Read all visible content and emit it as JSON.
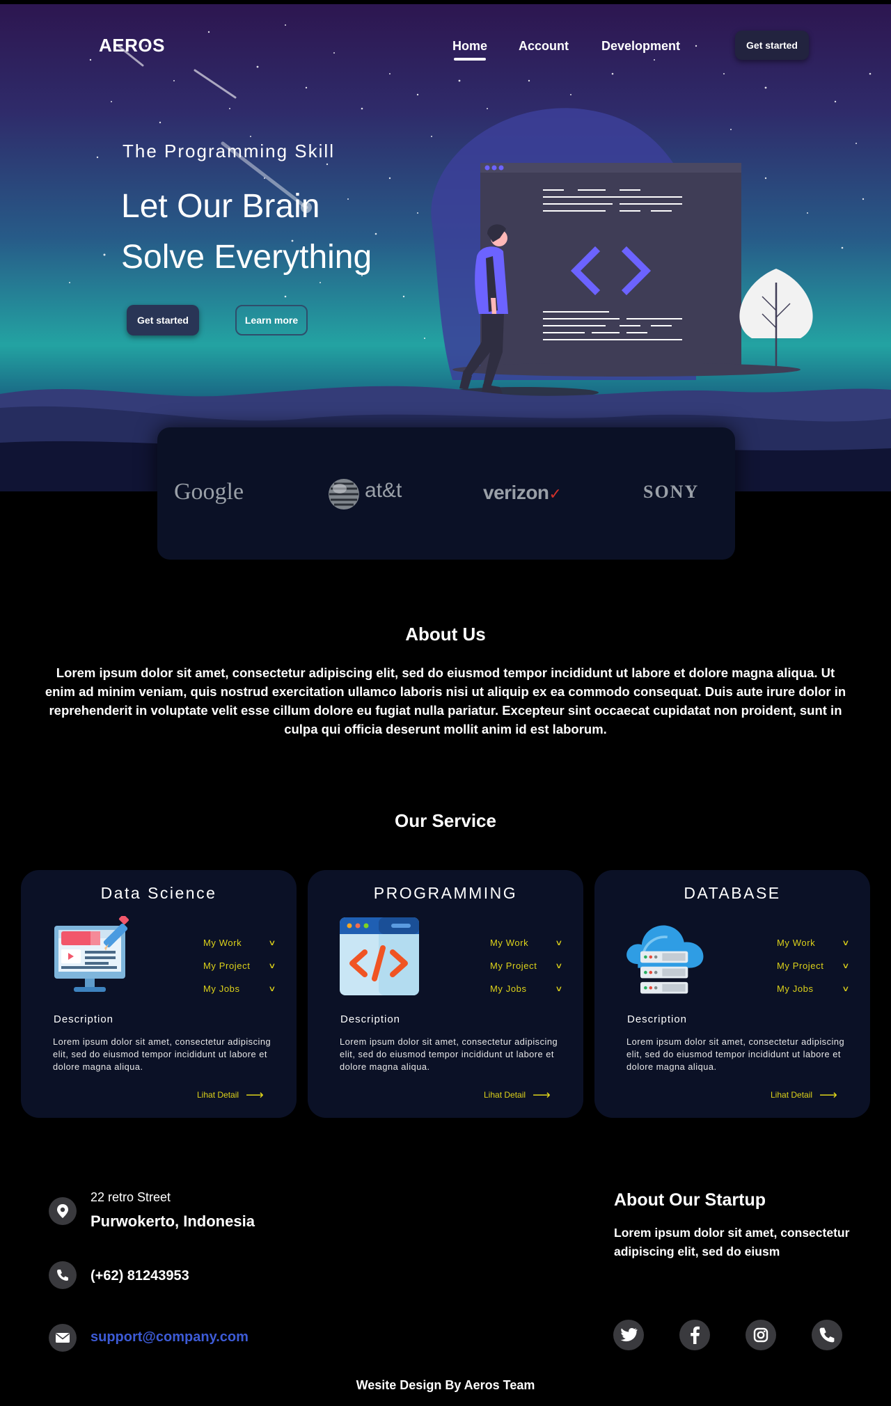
{
  "nav": {
    "logo": "AEROS",
    "links": [
      "Home",
      "Account",
      "Development"
    ],
    "cta": "Get started"
  },
  "hero": {
    "kicker": "The Programming Skill",
    "title_line1": "Let Our Brain",
    "title_line2": "Solve Everything",
    "primary_button": "Get started",
    "secondary_button": "Learn more"
  },
  "partners": {
    "google": "Google",
    "att": "at&t",
    "verizon": "verizon",
    "verizon_mark": "✓",
    "sony": "SONY"
  },
  "about": {
    "title": "About Us",
    "text": "Lorem ipsum dolor sit amet, consectetur adipiscing elit, sed do eiusmod tempor incididunt ut labore et dolore magna aliqua. Ut enim ad minim veniam, quis nostrud exercitation ullamco laboris nisi ut aliquip ex ea commodo consequat. Duis aute irure dolor in reprehenderit in voluptate velit esse cillum dolore eu fugiat nulla pariatur. Excepteur sint occaecat cupidatat non proident, sunt in culpa qui officia deserunt mollit anim id est laborum."
  },
  "services": {
    "title": "Our Service",
    "cards": [
      {
        "title": "Data Science",
        "icon": "monitor-design-icon",
        "menu": [
          "My Work",
          "My Project",
          "My Jobs"
        ],
        "description_label": "Description",
        "description": "Lorem ipsum dolor sit amet, consectetur adipiscing elit, sed do eiusmod tempor incididunt ut labore et dolore magna aliqua.",
        "link": "Lihat Detail"
      },
      {
        "title": "PROGRAMMING",
        "icon": "code-window-icon",
        "menu": [
          "My Work",
          "My Project",
          "My Jobs"
        ],
        "description_label": "Description",
        "description": "Lorem ipsum dolor sit amet, consectetur adipiscing elit, sed do eiusmod tempor incididunt ut labore et dolore magna aliqua.",
        "link": "Lihat Detail"
      },
      {
        "title": "DATABASE",
        "icon": "cloud-server-icon",
        "menu": [
          "My Work",
          "My Project",
          "My Jobs"
        ],
        "description_label": "Description",
        "description": "Lorem ipsum dolor sit amet, consectetur adipiscing elit, sed do eiusmod tempor incididunt ut labore et dolore magna aliqua.",
        "link": "Lihat Detail"
      }
    ]
  },
  "footer": {
    "address_line1": "22 retro Street",
    "address_line2": "Purwokerto, Indonesia",
    "phone": "(+62) 81243953",
    "email": "support@company.com",
    "about_title": "About Our Startup",
    "about_text": "Lorem ipsum dolor sit amet, consectetur adipiscing elit, sed do eiusm",
    "social": [
      "twitter-icon",
      "facebook-icon",
      "instagram-icon",
      "phone-icon"
    ],
    "credit": "Wesite Design By Aeros Team"
  },
  "colors": {
    "accent_yellow": "#ddd21a",
    "card_bg": "#0b1126",
    "link_blue": "#3d5bd6",
    "illustration_purple": "#6c63ff"
  }
}
